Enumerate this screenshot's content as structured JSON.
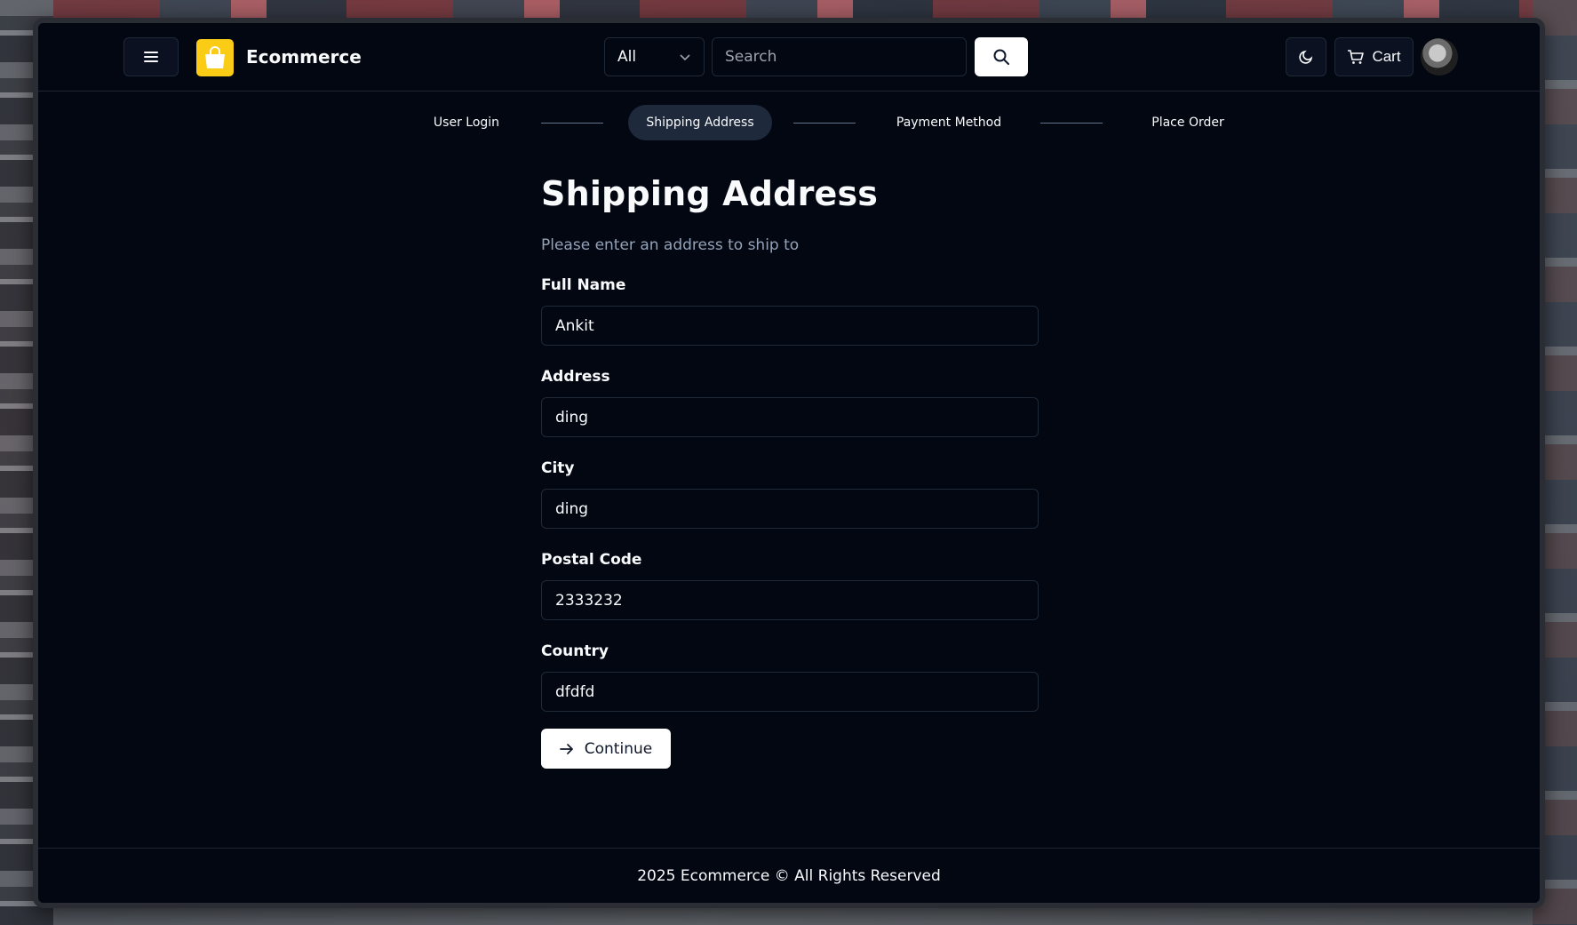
{
  "header": {
    "brand": "Ecommerce",
    "category": {
      "selected": "All"
    },
    "search": {
      "placeholder": "Search",
      "value": ""
    },
    "cart_label": "Cart"
  },
  "steps": [
    {
      "label": "User Login",
      "active": false
    },
    {
      "label": "Shipping Address",
      "active": true
    },
    {
      "label": "Payment Method",
      "active": false
    },
    {
      "label": "Place Order",
      "active": false
    }
  ],
  "form": {
    "title": "Shipping Address",
    "subtitle": "Please enter an address to ship to",
    "fields": [
      {
        "label": "Full Name",
        "value": "Ankit"
      },
      {
        "label": "Address",
        "value": "ding"
      },
      {
        "label": "City",
        "value": "ding"
      },
      {
        "label": "Postal Code",
        "value": "2333232"
      },
      {
        "label": "Country",
        "value": "dfdfd"
      }
    ],
    "submit_label": "Continue"
  },
  "footer": {
    "text": "2025 Ecommerce © All Rights Reserved"
  },
  "colors": {
    "background": "#030712",
    "logo_accent": "#facc15",
    "active_step": "#1e293b",
    "muted_text": "#94a3b8"
  },
  "icons": {
    "menu": "menu-icon",
    "logo": "shopping-bag-icon",
    "dropdown": "chevron-down-icon",
    "search": "search-icon",
    "theme": "moon-icon",
    "cart": "cart-icon",
    "continue": "arrow-right-icon"
  }
}
